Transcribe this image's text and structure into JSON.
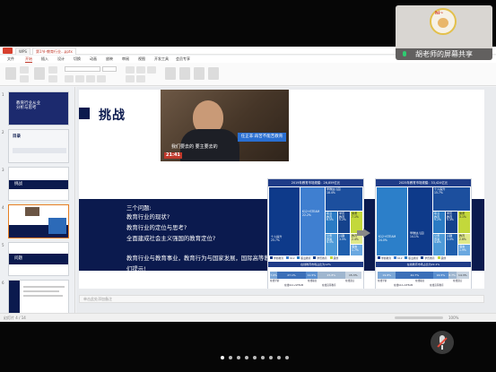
{
  "app": {
    "tabs": [
      "WPS",
      "第1节-教育行业...pptx"
    ],
    "menu": [
      "文件",
      "开始",
      "插入",
      "设计",
      "切换",
      "动画",
      "放映",
      "审阅",
      "视图",
      "开发工具",
      "会员专享"
    ]
  },
  "thumbnails": [
    {
      "num": "1",
      "title": "教育行业从业\n分析与思考"
    },
    {
      "num": "2",
      "title": "目录"
    },
    {
      "num": "3",
      "title": "挑战"
    },
    {
      "num": "4",
      "title": ""
    },
    {
      "num": "5",
      "title": "问题"
    },
    {
      "num": "6",
      "title": ""
    }
  ],
  "slide": {
    "title": "挑战",
    "video_caption": "我们要去的   要主要去的",
    "video_time": "21:41",
    "video_banner": "任正非:再苦不能苦教育",
    "body_lines": [
      "三个问题:",
      "教育行业的现状?",
      "教育行业的定位与思考?",
      "全面建成社会主义强国的教育定位?",
      "",
      "教育行业与教育事业，教育行为与国家发展，国际高等教育现状给我",
      "们提示!"
    ]
  },
  "charts": [
    {
      "title": "2019年教育市场规模：26,859亿元",
      "cells": [
        {
          "label": "个人提升\n25.7%"
        },
        {
          "label": "K12+STEAM\n22.2%"
        },
        {
          "label": "早教幼儿园\n18.4%"
        },
        {
          "label": "职业\n教育\n6.5%"
        },
        {
          "label": "学历\n教育\n5.2%"
        },
        {
          "label": "素质\n7.1%"
        },
        {
          "label": "公务\n员考\n4.5%"
        },
        {
          "label": "兴趣\n3.5%"
        },
        {
          "label": "教育\n2.4%"
        },
        {
          "label": "语言\n1.7%"
        }
      ],
      "stack_title": "在线教育市场占比为12%",
      "stack_values": [
        "7.0%",
        "27.1%",
        "11.5%",
        "25.8%",
        "15.3%"
      ],
      "stack_labels": [
        "在线学前",
        "在线K12+STEAM",
        "在线职业",
        "在线高等教育",
        "在线语言"
      ]
    },
    {
      "title": "2025年教育市场规模：33,424亿元",
      "cells": [
        {
          "label": "K12+STEAM\n24.0%"
        },
        {
          "label": "早教幼儿园\n14.1%"
        },
        {
          "label": "个人提升\n15.7%"
        },
        {
          "label": "职业\n教育\n9.2%"
        },
        {
          "label": "学历\n教育\n5.3%"
        },
        {
          "label": "素质\n3.1%"
        },
        {
          "label": "公务\n员考\n4.8%"
        },
        {
          "label": "兴趣\n3.0%"
        },
        {
          "label": "教育\n2.6%"
        },
        {
          "label": "语言\n1.9%"
        }
      ],
      "stack_title": "在线教育市场占比为22.2%",
      "stack_values": [
        "19.8%",
        "40.7%",
        "16.5%",
        "8.7%",
        "14.3%"
      ],
      "stack_labels": [
        "在线学前",
        "在线K12+STEAM",
        "在线职业",
        "在线高等教育",
        "在线语言"
      ]
    }
  ],
  "legend": [
    "学前教育",
    "K12",
    "职业教育",
    "学历教育",
    "其他"
  ],
  "notes_placeholder": "单击此处添加备注",
  "status": {
    "left": "幻灯片 4 / 14",
    "right": "100%"
  },
  "overlay": {
    "share_label": "胡老师的屏幕共享",
    "avatar_text": "hi~"
  },
  "pager": {
    "count": 9,
    "active": 0
  }
}
